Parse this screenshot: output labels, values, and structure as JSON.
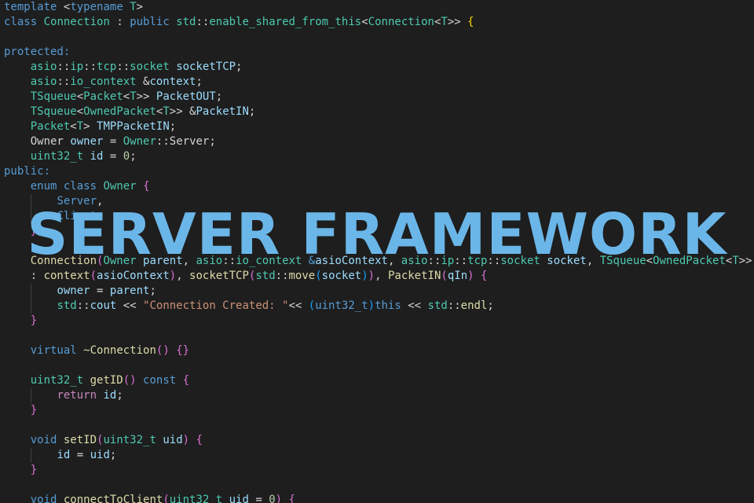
{
  "editor": {
    "watermark_text": "SERVER FRAMEWORK",
    "code_lines": [
      {
        "indent": 0,
        "tokens": [
          [
            "template",
            "kw"
          ],
          [
            " ",
            "pl"
          ],
          [
            "<",
            "pl"
          ],
          [
            "typename",
            "kw"
          ],
          [
            " ",
            "pl"
          ],
          [
            "T",
            "ty"
          ],
          [
            ">",
            "pl"
          ]
        ]
      },
      {
        "indent": 0,
        "tokens": [
          [
            "class",
            "kw"
          ],
          [
            " ",
            "pl"
          ],
          [
            "Connection",
            "ty"
          ],
          [
            " : ",
            "pl"
          ],
          [
            "public",
            "kw"
          ],
          [
            " ",
            "pl"
          ],
          [
            "std",
            "ty"
          ],
          [
            "::",
            "pl"
          ],
          [
            "enable_shared_from_this",
            "ty"
          ],
          [
            "<",
            "pl"
          ],
          [
            "Connection",
            "ty"
          ],
          [
            "<",
            "pl"
          ],
          [
            "T",
            "ty"
          ],
          [
            ">> ",
            "pl"
          ],
          [
            "{",
            "br1"
          ]
        ]
      },
      {
        "indent": 0,
        "tokens": []
      },
      {
        "indent": 0,
        "tokens": [
          [
            "protected:",
            "kw"
          ]
        ]
      },
      {
        "indent": 1,
        "tokens": [
          [
            "asio",
            "ty"
          ],
          [
            "::",
            "pl"
          ],
          [
            "ip",
            "ty"
          ],
          [
            "::",
            "pl"
          ],
          [
            "tcp",
            "ty"
          ],
          [
            "::",
            "pl"
          ],
          [
            "socket",
            "ty"
          ],
          [
            " ",
            "pl"
          ],
          [
            "socketTCP",
            "var"
          ],
          [
            ";",
            "pl"
          ]
        ]
      },
      {
        "indent": 1,
        "tokens": [
          [
            "asio",
            "ty"
          ],
          [
            "::",
            "pl"
          ],
          [
            "io_context",
            "ty"
          ],
          [
            " &",
            "pl"
          ],
          [
            "context",
            "var"
          ],
          [
            ";",
            "pl"
          ]
        ]
      },
      {
        "indent": 1,
        "tokens": [
          [
            "TSqueue",
            "ty"
          ],
          [
            "<",
            "pl"
          ],
          [
            "Packet",
            "ty"
          ],
          [
            "<",
            "pl"
          ],
          [
            "T",
            "ty"
          ],
          [
            ">> ",
            "pl"
          ],
          [
            "PacketOUT",
            "var"
          ],
          [
            ";",
            "pl"
          ]
        ]
      },
      {
        "indent": 1,
        "tokens": [
          [
            "TSqueue",
            "ty"
          ],
          [
            "<",
            "pl"
          ],
          [
            "OwnedPacket",
            "ty"
          ],
          [
            "<",
            "pl"
          ],
          [
            "T",
            "ty"
          ],
          [
            ">> &",
            "pl"
          ],
          [
            "PacketIN",
            "var"
          ],
          [
            ";",
            "pl"
          ]
        ]
      },
      {
        "indent": 1,
        "tokens": [
          [
            "Packet",
            "ty"
          ],
          [
            "<",
            "pl"
          ],
          [
            "T",
            "ty"
          ],
          [
            "> ",
            "pl"
          ],
          [
            "TMPPacketIN",
            "var"
          ],
          [
            ";",
            "pl"
          ]
        ]
      },
      {
        "indent": 1,
        "tokens": [
          [
            "Owner",
            "pl"
          ],
          [
            " ",
            "pl"
          ],
          [
            "owner",
            "var"
          ],
          [
            " = ",
            "pl"
          ],
          [
            "Owner",
            "ty"
          ],
          [
            "::",
            "pl"
          ],
          [
            "Server",
            "pl"
          ],
          [
            ";",
            "pl"
          ]
        ]
      },
      {
        "indent": 1,
        "tokens": [
          [
            "uint32_t",
            "ty"
          ],
          [
            " ",
            "pl"
          ],
          [
            "id",
            "var"
          ],
          [
            " = ",
            "pl"
          ],
          [
            "0",
            "num"
          ],
          [
            ";",
            "pl"
          ]
        ]
      },
      {
        "indent": 0,
        "tokens": [
          [
            "public:",
            "kw"
          ]
        ]
      },
      {
        "indent": 1,
        "tokens": [
          [
            "enum",
            "kw"
          ],
          [
            " ",
            "pl"
          ],
          [
            "class",
            "kw"
          ],
          [
            " ",
            "pl"
          ],
          [
            "Owner",
            "ty"
          ],
          [
            " ",
            "pl"
          ],
          [
            "{",
            "br2"
          ]
        ]
      },
      {
        "indent": 2,
        "tokens": [
          [
            "Server",
            "kw"
          ],
          [
            ",",
            "pl"
          ]
        ]
      },
      {
        "indent": 2,
        "tokens": [
          [
            "Client",
            "kw"
          ]
        ]
      },
      {
        "indent": 1,
        "tokens": [
          [
            "}",
            "br2"
          ],
          [
            ";",
            "pl"
          ]
        ]
      },
      {
        "indent": 0,
        "tokens": []
      },
      {
        "indent": 1,
        "tokens": [
          [
            "Connection",
            "fn"
          ],
          [
            "(",
            "br2"
          ],
          [
            "Owner",
            "ty"
          ],
          [
            " ",
            "pl"
          ],
          [
            "parent",
            "var"
          ],
          [
            ", ",
            "pl"
          ],
          [
            "asio",
            "ty"
          ],
          [
            "::",
            "pl"
          ],
          [
            "io_context",
            "ty"
          ],
          [
            " &",
            "kw"
          ],
          [
            "asioContext",
            "var"
          ],
          [
            ", ",
            "pl"
          ],
          [
            "asio",
            "ty"
          ],
          [
            "::",
            "pl"
          ],
          [
            "ip",
            "ty"
          ],
          [
            "::",
            "pl"
          ],
          [
            "tcp",
            "ty"
          ],
          [
            "::",
            "pl"
          ],
          [
            "socket",
            "ty"
          ],
          [
            " ",
            "pl"
          ],
          [
            "socket",
            "var"
          ],
          [
            ", ",
            "pl"
          ],
          [
            "TSqueue",
            "ty"
          ],
          [
            "<",
            "pl"
          ],
          [
            "OwnedPacket",
            "ty"
          ],
          [
            "<",
            "pl"
          ],
          [
            "T",
            "ty"
          ],
          [
            ">>",
            "pl"
          ]
        ]
      },
      {
        "indent": 1,
        "tokens": [
          [
            ": ",
            "pl"
          ],
          [
            "context",
            "fn"
          ],
          [
            "(",
            "br2"
          ],
          [
            "asioContext",
            "var"
          ],
          [
            ")",
            "br2"
          ],
          [
            ", ",
            "pl"
          ],
          [
            "socketTCP",
            "fn"
          ],
          [
            "(",
            "br2"
          ],
          [
            "std",
            "ty"
          ],
          [
            "::",
            "pl"
          ],
          [
            "move",
            "fn"
          ],
          [
            "(",
            "br3"
          ],
          [
            "socket",
            "var"
          ],
          [
            ")",
            "br3"
          ],
          [
            ")",
            "br2"
          ],
          [
            ", ",
            "pl"
          ],
          [
            "PacketIN",
            "fn"
          ],
          [
            "(",
            "br2"
          ],
          [
            "qIn",
            "var"
          ],
          [
            ")",
            "br2"
          ],
          [
            " ",
            "pl"
          ],
          [
            "{",
            "br2"
          ]
        ]
      },
      {
        "indent": 2,
        "tokens": [
          [
            "owner",
            "var"
          ],
          [
            " = ",
            "pl"
          ],
          [
            "parent",
            "var"
          ],
          [
            ";",
            "pl"
          ]
        ]
      },
      {
        "indent": 2,
        "tokens": [
          [
            "std",
            "ty"
          ],
          [
            "::",
            "pl"
          ],
          [
            "cout",
            "var"
          ],
          [
            " << ",
            "pl"
          ],
          [
            "\"Connection Created: \"",
            "str"
          ],
          [
            "<< ",
            "pl"
          ],
          [
            "(",
            "br3"
          ],
          [
            "uint32_t",
            "kw"
          ],
          [
            ")",
            "br3"
          ],
          [
            "this",
            "kw"
          ],
          [
            " << ",
            "pl"
          ],
          [
            "std",
            "ty"
          ],
          [
            "::",
            "pl"
          ],
          [
            "endl",
            "fn"
          ],
          [
            ";",
            "pl"
          ]
        ]
      },
      {
        "indent": 1,
        "tokens": [
          [
            "}",
            "br2"
          ]
        ]
      },
      {
        "indent": 0,
        "tokens": []
      },
      {
        "indent": 1,
        "tokens": [
          [
            "virtual",
            "kw"
          ],
          [
            " ",
            "pl"
          ],
          [
            "~Connection",
            "fn"
          ],
          [
            "()",
            "br2"
          ],
          [
            " ",
            "pl"
          ],
          [
            "{}",
            "br2"
          ]
        ]
      },
      {
        "indent": 0,
        "tokens": []
      },
      {
        "indent": 1,
        "tokens": [
          [
            "uint32_t",
            "ty"
          ],
          [
            " ",
            "pl"
          ],
          [
            "getID",
            "fn"
          ],
          [
            "()",
            "br2"
          ],
          [
            " ",
            "pl"
          ],
          [
            "const",
            "kw"
          ],
          [
            " ",
            "pl"
          ],
          [
            "{",
            "br2"
          ]
        ]
      },
      {
        "indent": 2,
        "tokens": [
          [
            "return",
            "ctl"
          ],
          [
            " ",
            "pl"
          ],
          [
            "id",
            "var"
          ],
          [
            ";",
            "pl"
          ]
        ]
      },
      {
        "indent": 1,
        "tokens": [
          [
            "}",
            "br2"
          ]
        ]
      },
      {
        "indent": 0,
        "tokens": []
      },
      {
        "indent": 1,
        "tokens": [
          [
            "void",
            "kw"
          ],
          [
            " ",
            "pl"
          ],
          [
            "setID",
            "fn"
          ],
          [
            "(",
            "br2"
          ],
          [
            "uint32_t",
            "ty"
          ],
          [
            " ",
            "pl"
          ],
          [
            "uid",
            "var"
          ],
          [
            ")",
            "br2"
          ],
          [
            " ",
            "pl"
          ],
          [
            "{",
            "br2"
          ]
        ]
      },
      {
        "indent": 2,
        "tokens": [
          [
            "id",
            "var"
          ],
          [
            " = ",
            "pl"
          ],
          [
            "uid",
            "var"
          ],
          [
            ";",
            "pl"
          ]
        ]
      },
      {
        "indent": 1,
        "tokens": [
          [
            "}",
            "br2"
          ]
        ]
      },
      {
        "indent": 0,
        "tokens": []
      },
      {
        "indent": 1,
        "tokens": [
          [
            "void",
            "kw"
          ],
          [
            " ",
            "pl"
          ],
          [
            "connectToClient",
            "fn"
          ],
          [
            "(",
            "br2"
          ],
          [
            "uint32_t",
            "ty"
          ],
          [
            " ",
            "pl"
          ],
          [
            "uid",
            "var"
          ],
          [
            " = ",
            "pl"
          ],
          [
            "0",
            "num"
          ],
          [
            ")",
            "br2"
          ],
          [
            " ",
            "pl"
          ],
          [
            "{",
            "br2"
          ]
        ]
      }
    ]
  }
}
